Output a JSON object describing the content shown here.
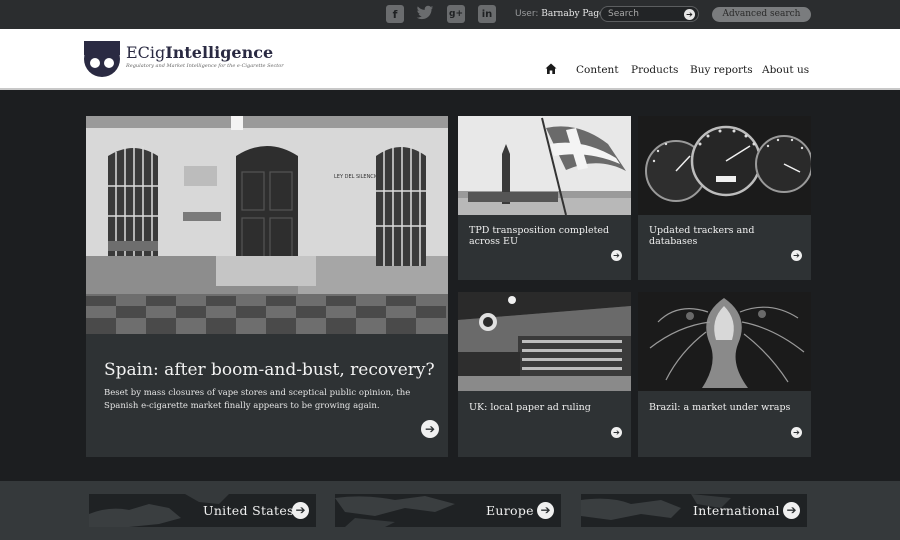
{
  "topbar": {
    "social": [
      {
        "name": "facebook-icon",
        "glyph": "f"
      },
      {
        "name": "twitter-icon",
        "glyph": "🐦"
      },
      {
        "name": "google-plus-icon",
        "glyph": "g+"
      },
      {
        "name": "linkedin-icon",
        "glyph": "in"
      }
    ],
    "user_label": "User: ",
    "user_name": "Barnaby Page",
    "search_placeholder": "Search",
    "search_go": "➔",
    "advanced_search": "Advanced search"
  },
  "header": {
    "brand_prefix": "ECig",
    "brand_bold": "Intelligence",
    "tagline": "Regulatory and Market Intelligence for the e-Cigarette Sector",
    "nav": [
      "Content",
      "Products",
      "Buy reports",
      "About us"
    ],
    "home_icon": "home-icon"
  },
  "feature": {
    "title": "Spain: after boom-and-bust, recovery?",
    "description": "Beset by mass closures of vape stores and sceptical public opinion, the Spanish e-cigarette market finally appears to be growing again.",
    "arrow": "➔",
    "sign_text": "LEY DEL SILENCIO"
  },
  "tiles": [
    {
      "title": "TPD transposition completed across EU",
      "arrow": "➔"
    },
    {
      "title": "Updated trackers and databases",
      "arrow": "➔"
    },
    {
      "title": "UK: local paper ad ruling",
      "arrow": "➔"
    },
    {
      "title": "Brazil: a market under wraps",
      "arrow": "➔"
    }
  ],
  "regions": [
    {
      "label": "United States",
      "arrow": "➔"
    },
    {
      "label": "Europe",
      "arrow": "➔"
    },
    {
      "label": "International",
      "arrow": "➔"
    }
  ],
  "colors": {
    "accent_dark": "#2e3234",
    "page_bg": "#1c1e20",
    "brand_navy": "#2a2a42"
  }
}
